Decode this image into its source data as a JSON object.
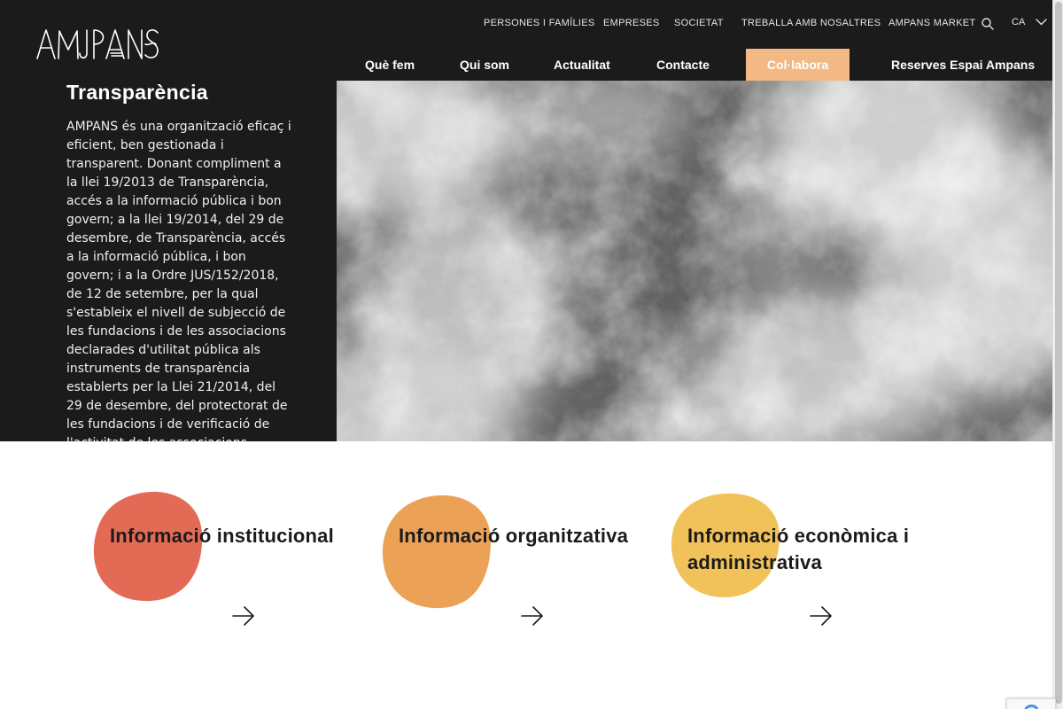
{
  "header": {
    "logo_text": "AMPANS",
    "top_nav": [
      {
        "label": "PERSONES I FAMÍLIES"
      },
      {
        "label": "EMPRESES"
      },
      {
        "label": "SOCIETAT"
      },
      {
        "label": "TREBALLA AMB NOSALTRES"
      },
      {
        "label": "AMPANS MARKET"
      }
    ],
    "language": "CA",
    "main_nav": [
      {
        "label": "Què fem"
      },
      {
        "label": "Qui som"
      },
      {
        "label": "Actualitat"
      },
      {
        "label": "Contacte"
      },
      {
        "label": "Col·labora"
      },
      {
        "label": "Reserves Espai Ampans"
      }
    ]
  },
  "hero": {
    "title": "Transparència",
    "text": "AMPANS és una organització eficaç i eficient, ben gestionada i transparent. Donant compliment a la llei 19/2013 de Transparència, accés a la informació pública i bon govern; a la llei 19/2014, del 29 de desembre, de Transparència, accés a la informació pública, i bon govern; i a la Ordre JUS/152/2018, de 12 de setembre, per la qual s'estableix el nivell de subjecció de les fundacions i de les associacions declarades d'utilitat pública als instruments de transparència establerts per la Llei 21/2014, del 29 de desembre, del protectorat de les fundacions i de verificació de l'activitat de les associacions declarades d'utilitat pública, presentem la nostra activitat."
  },
  "cards": [
    {
      "title": "Informació institucional",
      "color": "#e36a55"
    },
    {
      "title": "Informació organitzativa",
      "color": "#eba257"
    },
    {
      "title": "Informació econòmica i administrativa",
      "color": "#f2c25a"
    }
  ],
  "colors": {
    "header_bg": "#1b1b1b",
    "accent": "#f2b984"
  },
  "icons": {
    "search": "search-icon",
    "language_dropdown": "chevron-down-icon",
    "card_arrow": "arrow-right-icon"
  }
}
